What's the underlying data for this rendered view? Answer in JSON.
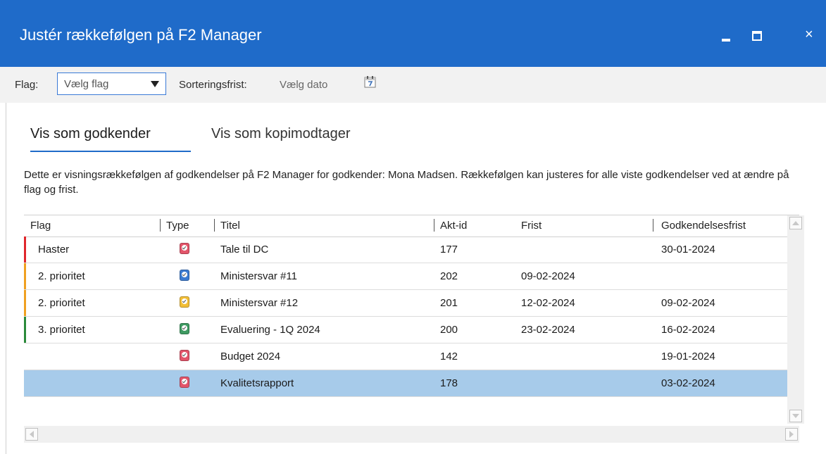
{
  "window": {
    "title": "Justér rækkefølgen på F2 Manager",
    "close_glyph": "×",
    "accent_color": "#1f6bc9"
  },
  "toolbar": {
    "flag_label": "Flag:",
    "flag_value": "Vælg flag",
    "deadline_label": "Sorteringsfrist:",
    "date_value": "Vælg dato",
    "calendar_icon": "calendar-icon"
  },
  "tabs": [
    {
      "label": "Vis som godkender",
      "active": true
    },
    {
      "label": "Vis som kopimodtager",
      "active": false
    }
  ],
  "description": "Dette er visningsrækkefølgen af godkendelser på F2 Manager for godkender: Mona Madsen. Rækkefølgen kan justeres for alle viste godkendelser ved at ændre på flag og frist.",
  "table": {
    "columns": [
      "Flag",
      "Type",
      "Titel",
      "Akt-id",
      "Frist",
      "Godkendelsesfrist"
    ],
    "rows": [
      {
        "flag": "Haster",
        "flag_color": "#e0262b",
        "type_icon": "approval-icon-red",
        "type_color": "#e2556a",
        "title": "Tale til DC",
        "akt_id": "177",
        "frist": "",
        "godkendelsesfrist": "30-01-2024"
      },
      {
        "flag": "2. prioritet",
        "flag_color": "#f0a020",
        "type_icon": "approval-icon-blue",
        "type_color": "#3b7bd1",
        "title": "Ministersvar #11",
        "akt_id": "202",
        "frist": "09-02-2024",
        "godkendelsesfrist": ""
      },
      {
        "flag": "2. prioritet",
        "flag_color": "#f0a020",
        "type_icon": "approval-icon-yellow",
        "type_color": "#f2be36",
        "title": "Ministersvar #12",
        "akt_id": "201",
        "frist": "12-02-2024",
        "godkendelsesfrist": "09-02-2024"
      },
      {
        "flag": "3. prioritet",
        "flag_color": "#2a8a3a",
        "type_icon": "approval-icon-green",
        "type_color": "#3f9a62",
        "title": "Evaluering - 1Q 2024",
        "akt_id": "200",
        "frist": "23-02-2024",
        "godkendelsesfrist": "16-02-2024"
      },
      {
        "flag": "",
        "flag_color": "",
        "type_icon": "approval-icon-red",
        "type_color": "#e2556a",
        "title": "Budget 2024",
        "akt_id": "142",
        "frist": "",
        "godkendelsesfrist": "19-01-2024"
      },
      {
        "flag": "",
        "flag_color": "",
        "type_icon": "approval-icon-red",
        "type_color": "#e2556a",
        "title": "Kvalitetsrapport",
        "akt_id": "178",
        "frist": "",
        "godkendelsesfrist": "03-02-2024",
        "selected": true
      }
    ]
  }
}
